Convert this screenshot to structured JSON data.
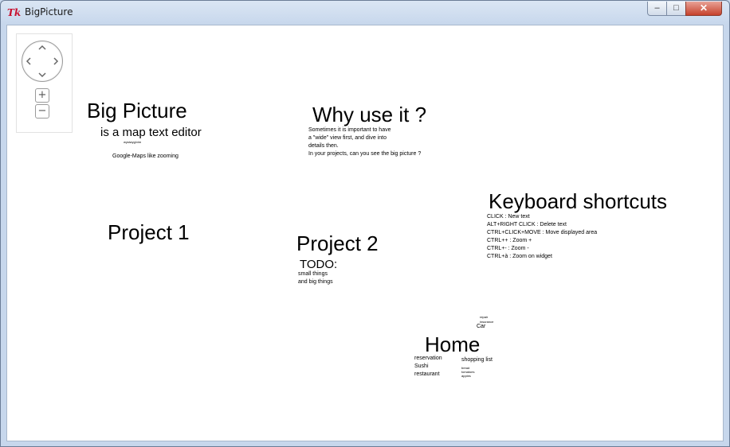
{
  "window": {
    "title": "BigPicture",
    "app_icon": "Tk"
  },
  "controls": {
    "minimize": "–",
    "maximize": "□",
    "close": "✕"
  },
  "nav": {
    "zoom_in": "+",
    "zoom_out": "−"
  },
  "canvas": {
    "big_picture": {
      "title": "Big Picture",
      "subtitle": "is a map text editor",
      "tiny": "wysiwyg/vim",
      "note": "Google-Maps like zooming"
    },
    "why": {
      "title": "Why use it ?",
      "lines": [
        "Sometimes it is important to have",
        "a \"wide\" view first, and dive into",
        "details then.",
        "In your projects, can you see the big picture ?"
      ]
    },
    "shortcuts": {
      "title": "Keyboard shortcuts",
      "lines": [
        "CLICK : New text",
        "ALT+RIGHT CLICK : Delete text",
        "CTRL+CLICK+MOVE : Move displayed area",
        "CTRL++ : Zoom +",
        "CTRL+- : Zoom -",
        "CTRL+à : Zoom on widget"
      ]
    },
    "project1": {
      "title": "Project 1"
    },
    "project2": {
      "title": "Project 2",
      "todo": "TODO:",
      "lines": [
        "small things",
        "and big things"
      ]
    },
    "home": {
      "title": "Home",
      "car_tiny": [
        "repair",
        "insurance"
      ],
      "car": "Car",
      "sushi": [
        "reservation",
        "Sushi",
        "restaurant"
      ],
      "shopping": "shopping list",
      "shopping_tiny": [
        "bread",
        "tomatoes",
        "apples"
      ]
    }
  }
}
